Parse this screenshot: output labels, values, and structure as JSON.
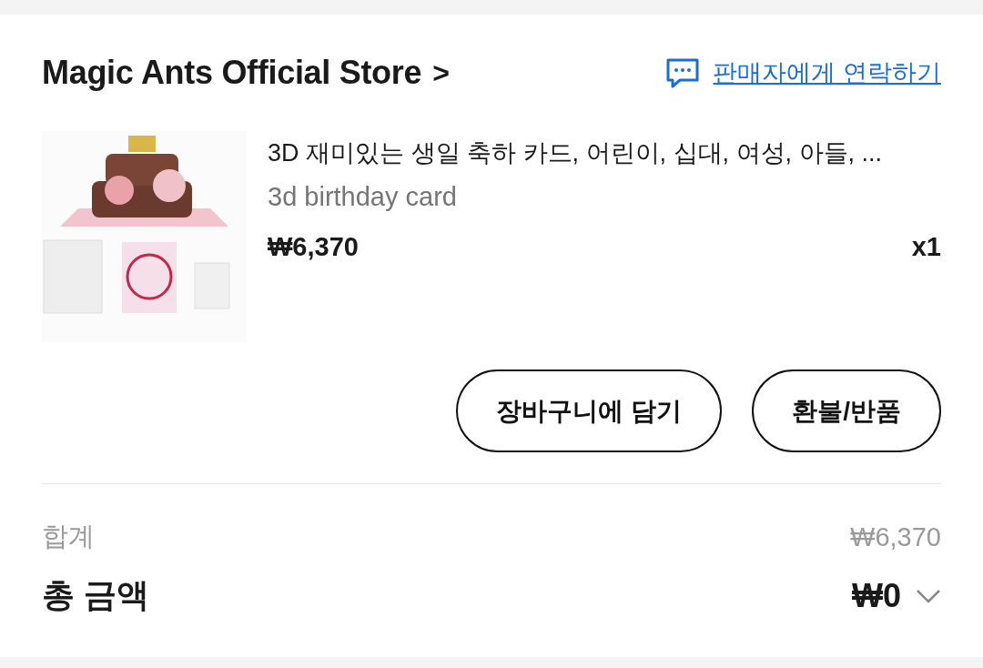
{
  "store": {
    "name": "Magic Ants Official Store",
    "chevron": ">",
    "contact": "판매자에게 연락하기"
  },
  "item": {
    "title": "3D 재미있는 생일 축하 카드, 어린이, 십대, 여성, 아들, ...",
    "variant": "3d birthday card",
    "price": "₩6,370",
    "quantity": "x1"
  },
  "buttons": [
    "장바구니에 담기",
    "환불/반품"
  ],
  "summary": {
    "subtotal_label": "합계",
    "subtotal": "₩6,370",
    "total_label": "총 금액",
    "total": "₩0",
    "expanded": false
  }
}
